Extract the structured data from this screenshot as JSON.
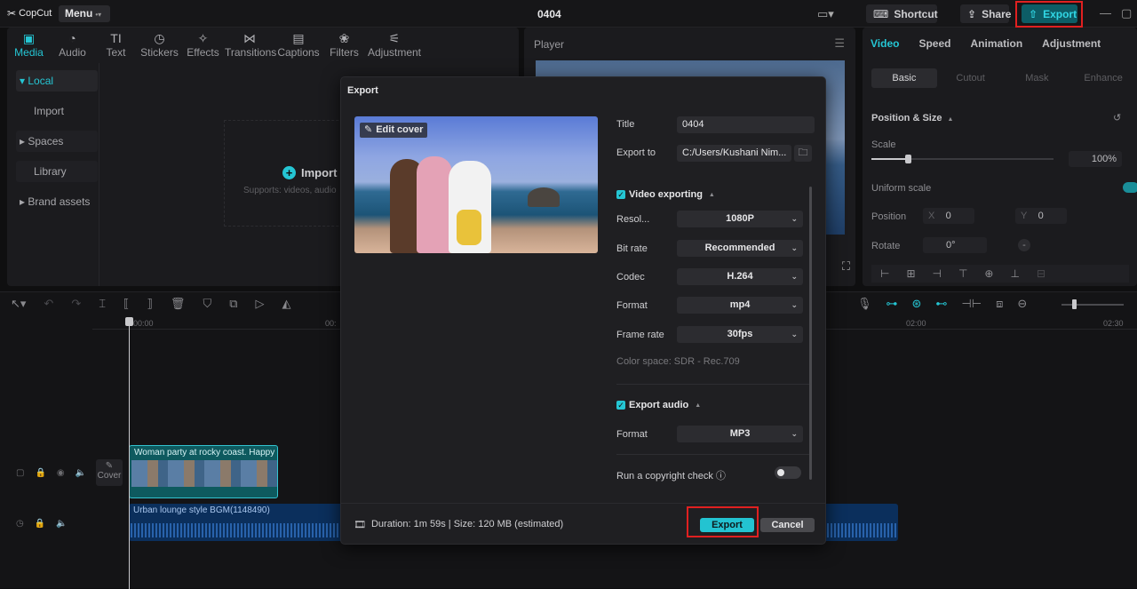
{
  "topbar": {
    "logo": "CopCut",
    "menu_label": "Menu",
    "project_title": "0404",
    "shortcut_label": "Shortcut",
    "share_label": "Share",
    "export_label": "Export"
  },
  "media_tools": [
    {
      "label": "Media",
      "icon": "▣"
    },
    {
      "label": "Audio",
      "icon": "◔"
    },
    {
      "label": "Text",
      "icon": "TI"
    },
    {
      "label": "Stickers",
      "icon": "◷"
    },
    {
      "label": "Effects",
      "icon": "✧"
    },
    {
      "label": "Transitions",
      "icon": "⋈"
    },
    {
      "label": "Captions",
      "icon": "▤"
    },
    {
      "label": "Filters",
      "icon": "❀"
    },
    {
      "label": "Adjustment",
      "icon": "⚟"
    }
  ],
  "side_nav": {
    "local": "Local",
    "import": "Import",
    "spaces": "Spaces",
    "library": "Library",
    "brand_assets": "Brand assets"
  },
  "media_area": {
    "import_label": "Import",
    "import_sub": "Supports: videos, audio"
  },
  "player": {
    "title": "Player"
  },
  "right_panel": {
    "tabs": [
      "Video",
      "Speed",
      "Animation",
      "Adjustment"
    ],
    "subtabs": [
      "Basic",
      "Cutout",
      "Mask",
      "Enhance"
    ],
    "position_size": "Position & Size",
    "scale_label": "Scale",
    "scale_value": "100%",
    "uniform_scale": "Uniform scale",
    "position_label": "Position",
    "pos_x_label": "X",
    "pos_x": "0",
    "pos_y_label": "Y",
    "pos_y": "0",
    "rotate_label": "Rotate",
    "rotate_value": "0°"
  },
  "timeline": {
    "ruler": [
      "00:00",
      "00:",
      "02:00",
      "02:30"
    ],
    "cover_label": "Cover",
    "video_clip_label": "Woman party at rocky coast. Happy",
    "audio_clip_label": "Urban lounge style BGM(1148490)"
  },
  "export_dialog": {
    "title": "Export",
    "edit_cover": "Edit cover",
    "title_label": "Title",
    "title_value": "0404",
    "export_to_label": "Export to",
    "export_to_value": "C:/Users/Kushani Nim...",
    "video_exporting": "Video exporting",
    "resolution_label": "Resol...",
    "resolution_value": "1080P",
    "bitrate_label": "Bit rate",
    "bitrate_value": "Recommended",
    "codec_label": "Codec",
    "codec_value": "H.264",
    "format_label": "Format",
    "format_value": "mp4",
    "framerate_label": "Frame rate",
    "framerate_value": "30fps",
    "color_space": "Color space: SDR - Rec.709",
    "export_audio": "Export audio",
    "audio_format_label": "Format",
    "audio_format_value": "MP3",
    "copyright_label": "Run a copyright check",
    "duration_info": "Duration: 1m 59s | Size: 120 MB (estimated)",
    "export_button": "Export",
    "cancel_button": "Cancel"
  }
}
